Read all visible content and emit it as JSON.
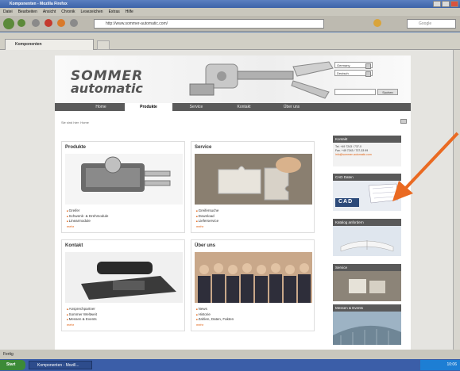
{
  "window": {
    "title": "Komponenten - Mozilla Firefox",
    "controls": [
      "minimize",
      "maximize",
      "close"
    ]
  },
  "menu": [
    "Datei",
    "Bearbeiten",
    "Ansicht",
    "Chronik",
    "Lesezeichen",
    "Extras",
    "Hilfe"
  ],
  "toolbar": {
    "url": "http://www.sommer-automatic.com/",
    "search_placeholder": "Google"
  },
  "tab": {
    "label": "Komponenten"
  },
  "site": {
    "logo_line1": "SOMMER",
    "logo_line2": "automatic",
    "country_select": "Germany",
    "language_select": "Deutsch",
    "search_button": "Suchen",
    "nav": [
      "Home",
      "Produkte",
      "Service",
      "Kontakt",
      "Über uns"
    ],
    "active_nav": "Produkte",
    "breadcrumb": "Sie sind hier: Home",
    "boxes": {
      "produkte": {
        "title": "Produkte",
        "items": [
          "Greifer",
          "Schwenk- & Drehmodule",
          "Linearmodule"
        ],
        "more": "mehr"
      },
      "service": {
        "title": "Service",
        "items": [
          "Greifersuche",
          "Download",
          "Lieferservice"
        ],
        "more": "mehr"
      },
      "kontakt": {
        "title": "Kontakt",
        "items": [
          "Ansprechpartner",
          "Sommer Weltweit",
          "Messen & Events"
        ],
        "more": "mehr"
      },
      "ueberuns": {
        "title": "Über uns",
        "items": [
          "News",
          "Historie",
          "Zahlen, Daten, Fakten"
        ],
        "more": "mehr"
      }
    },
    "sidebar": {
      "kontakt_title": "Kontakt",
      "tel": "Tel. +49 7243 / 737-0",
      "fax": "Fax. +49 7243 / 737-33 99",
      "email": "info@sommer-automatic.com",
      "cad_title": "CAD Daten",
      "cad_label": "CAD",
      "katalog_title": "Katalog anfordern",
      "service_title": "Service",
      "messen_title": "Messen & Events"
    },
    "accent_color": "#e06010"
  },
  "status": {
    "text": "Fertig"
  },
  "taskbar": {
    "start": "Start",
    "task": "Komponenten - Mozill...",
    "clock": "10:06"
  }
}
